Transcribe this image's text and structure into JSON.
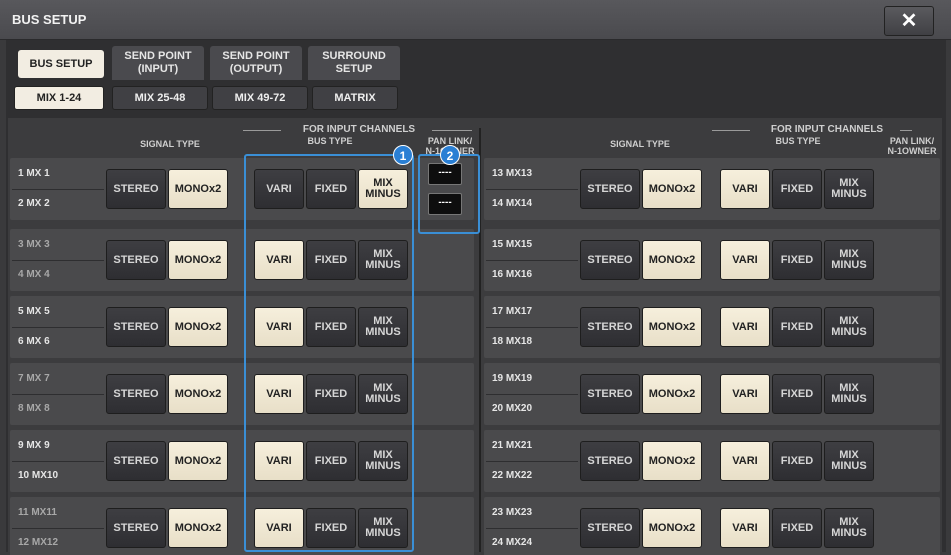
{
  "window": {
    "title": "BUS SETUP",
    "close_icon": "✕"
  },
  "tabs": [
    {
      "label": "BUS SETUP",
      "active": true
    },
    {
      "label": "SEND POINT\n(INPUT)"
    },
    {
      "label": "SEND POINT\n(OUTPUT)"
    },
    {
      "label": "SURROUND\nSETUP"
    }
  ],
  "subtabs": [
    {
      "label": "MIX 1-24",
      "active": true
    },
    {
      "label": "MIX 25-48"
    },
    {
      "label": "MIX 49-72"
    },
    {
      "label": "MATRIX"
    }
  ],
  "headers": {
    "signal_type": "SIGNAL TYPE",
    "for_input_channels": "FOR INPUT CHANNELS",
    "bus_type": "BUS TYPE",
    "pan_link_left": "PAN LINK/\nN-1OWNER",
    "pan_link_right": "PAN LINK/\nN-1OWNER"
  },
  "buttons": {
    "stereo": "STEREO",
    "mono": "MONOx2",
    "vari": "VARI",
    "fixed": "FIXED",
    "mix_minus": "MIX\nMINUS",
    "pan_value": "----"
  },
  "callouts": [
    "1",
    "2"
  ],
  "left_rows": [
    {
      "a": "1 MX 1",
      "b": "2 MX 2",
      "bus": "mixminus"
    },
    {
      "a": "3 MX 3",
      "b": "4 MX 4",
      "bus": "vari"
    },
    {
      "a": "5 MX 5",
      "b": "6 MX 6",
      "bus": "vari"
    },
    {
      "a": "7 MX 7",
      "b": "8 MX 8",
      "bus": "vari"
    },
    {
      "a": "9 MX 9",
      "b": "10 MX10",
      "bus": "vari"
    },
    {
      "a": "11 MX11",
      "b": "12 MX12",
      "bus": "vari"
    }
  ],
  "right_rows": [
    {
      "a": "13 MX13",
      "b": "14 MX14",
      "bus": "vari"
    },
    {
      "a": "15 MX15",
      "b": "16 MX16",
      "bus": "vari"
    },
    {
      "a": "17 MX17",
      "b": "18 MX18",
      "bus": "vari"
    },
    {
      "a": "19 MX19",
      "b": "20 MX20",
      "bus": "vari"
    },
    {
      "a": "21 MX21",
      "b": "22 MX22",
      "bus": "vari"
    },
    {
      "a": "23 MX23",
      "b": "24 MX24",
      "bus": "vari"
    }
  ],
  "colors": {
    "accent_blue": "#2a7fd4",
    "button_on": "#f2ede2"
  }
}
